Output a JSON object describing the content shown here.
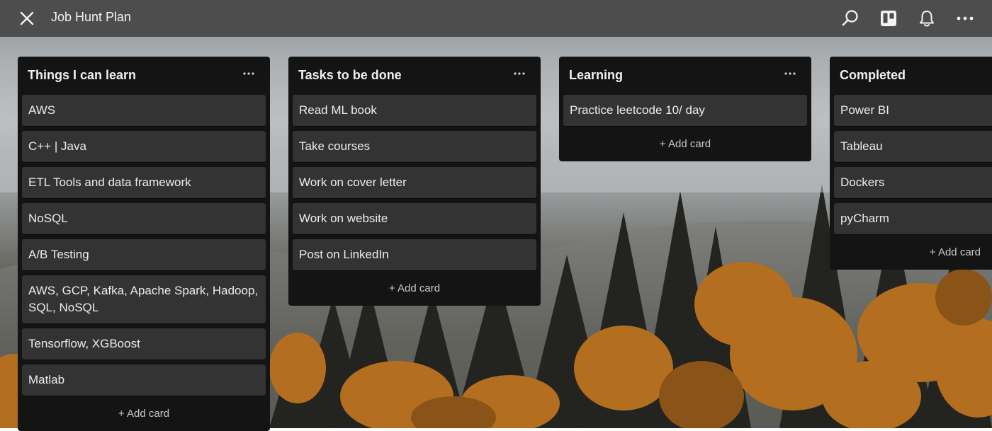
{
  "header": {
    "title": "Job Hunt Plan",
    "icons": [
      "close-icon",
      "search-icon",
      "board-view-icon",
      "bell-icon",
      "more-icon"
    ]
  },
  "colors": {
    "topbar": "#4d4d4d",
    "list_bg": "#141414",
    "card_bg": "#333333",
    "text": "#ececec"
  },
  "lists": [
    {
      "title": "Things I can learn",
      "cards": [
        "AWS",
        "C++ | Java",
        "ETL Tools and data framework",
        "NoSQL",
        "A/B Testing",
        "AWS, GCP, Kafka, Apache Spark, Hadoop, SQL, NoSQL",
        "Tensorflow, XGBoost",
        "Matlab"
      ],
      "add_label": "+ Add card"
    },
    {
      "title": "Tasks to be done",
      "cards": [
        "Read ML book",
        "Take courses",
        "Work on cover letter",
        "Work on website",
        "Post on LinkedIn"
      ],
      "add_label": "+ Add card"
    },
    {
      "title": "Learning",
      "cards": [
        "Practice leetcode 10/ day"
      ],
      "add_label": "+ Add card"
    },
    {
      "title": "Completed",
      "cards": [
        "Power BI",
        "Tableau",
        "Dockers",
        "pyCharm"
      ],
      "add_label": "+ Add card"
    }
  ]
}
